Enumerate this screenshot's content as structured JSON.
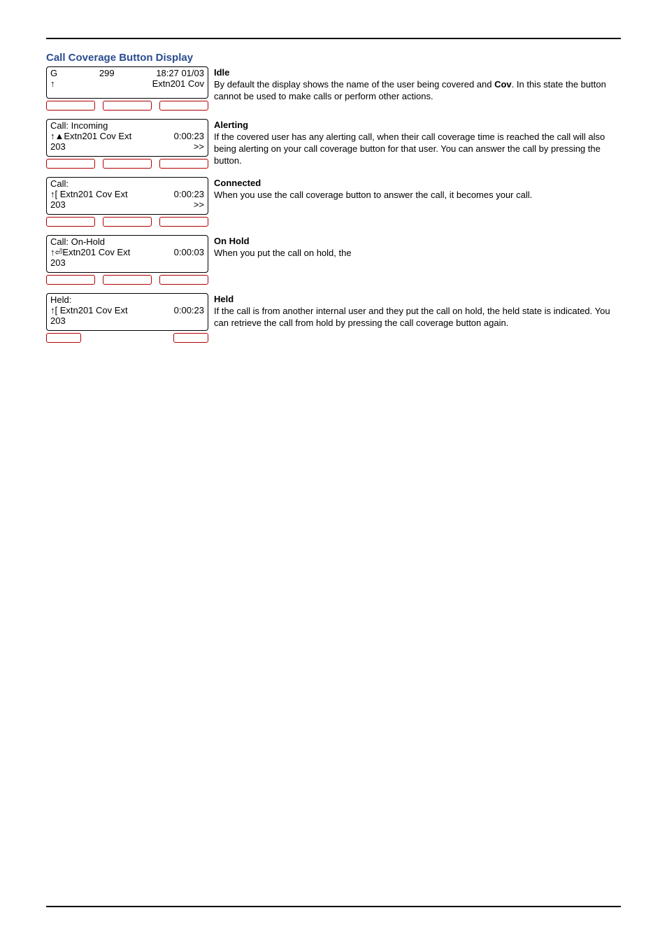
{
  "title": "Call Coverage Button Display",
  "rows": [
    {
      "phone": {
        "line1": {
          "left": "G",
          "mid": "299",
          "right": "18:27  01/03"
        },
        "line2": {
          "left": "↑",
          "right": "Extn201 Cov"
        },
        "line3": {
          "left": "",
          "right": ""
        }
      },
      "desc": {
        "heading": "Idle",
        "body_pre": "By default the display shows the name of the user being covered and ",
        "body_strong": "Cov",
        "body_post": ". In this state the button cannot be used to make calls or perform other actions."
      }
    },
    {
      "phone": {
        "line1": {
          "left": "Call: Incoming",
          "right": ""
        },
        "line2": {
          "left": "↑▲Extn201 Cov Ext",
          "right": "0:00:23"
        },
        "line3": {
          "left": "203",
          "right": ">>"
        }
      },
      "desc": {
        "heading": "Alerting",
        "body": "If the covered user has any alerting call, when their call coverage time is reached the call will also being alerting on your call coverage button for that user. You can answer the call by pressing the button."
      }
    },
    {
      "phone": {
        "line1": {
          "left": "Call:",
          "right": ""
        },
        "line2": {
          "left": "↑[ Extn201 Cov Ext",
          "right": "0:00:23"
        },
        "line3": {
          "left": "203",
          "right": ">>"
        }
      },
      "desc": {
        "heading": "Connected",
        "body": "When you use the call coverage button to answer the call, it becomes your call."
      }
    },
    {
      "phone": {
        "line1": {
          "left": "Call: On-Hold",
          "right": ""
        },
        "line2": {
          "left": "↑⏎Extn201 Cov Ext",
          "right": "0:00:03"
        },
        "line3": {
          "left": "203",
          "right": ""
        }
      },
      "desc": {
        "heading": "On Hold",
        "body": "When you put the call on hold, the"
      }
    },
    {
      "phone": {
        "line1": {
          "left": "Held:",
          "right": ""
        },
        "line2": {
          "left": "↑[ Extn201 Cov Ext",
          "right": "0:00:23"
        },
        "line3": {
          "left": "203",
          "right": ""
        }
      },
      "desc": {
        "heading": "Held",
        "body": "If the call is from another internal user and they put the call on hold, the held state is indicated. You can retrieve the call from hold by pressing the call coverage button again."
      }
    }
  ]
}
